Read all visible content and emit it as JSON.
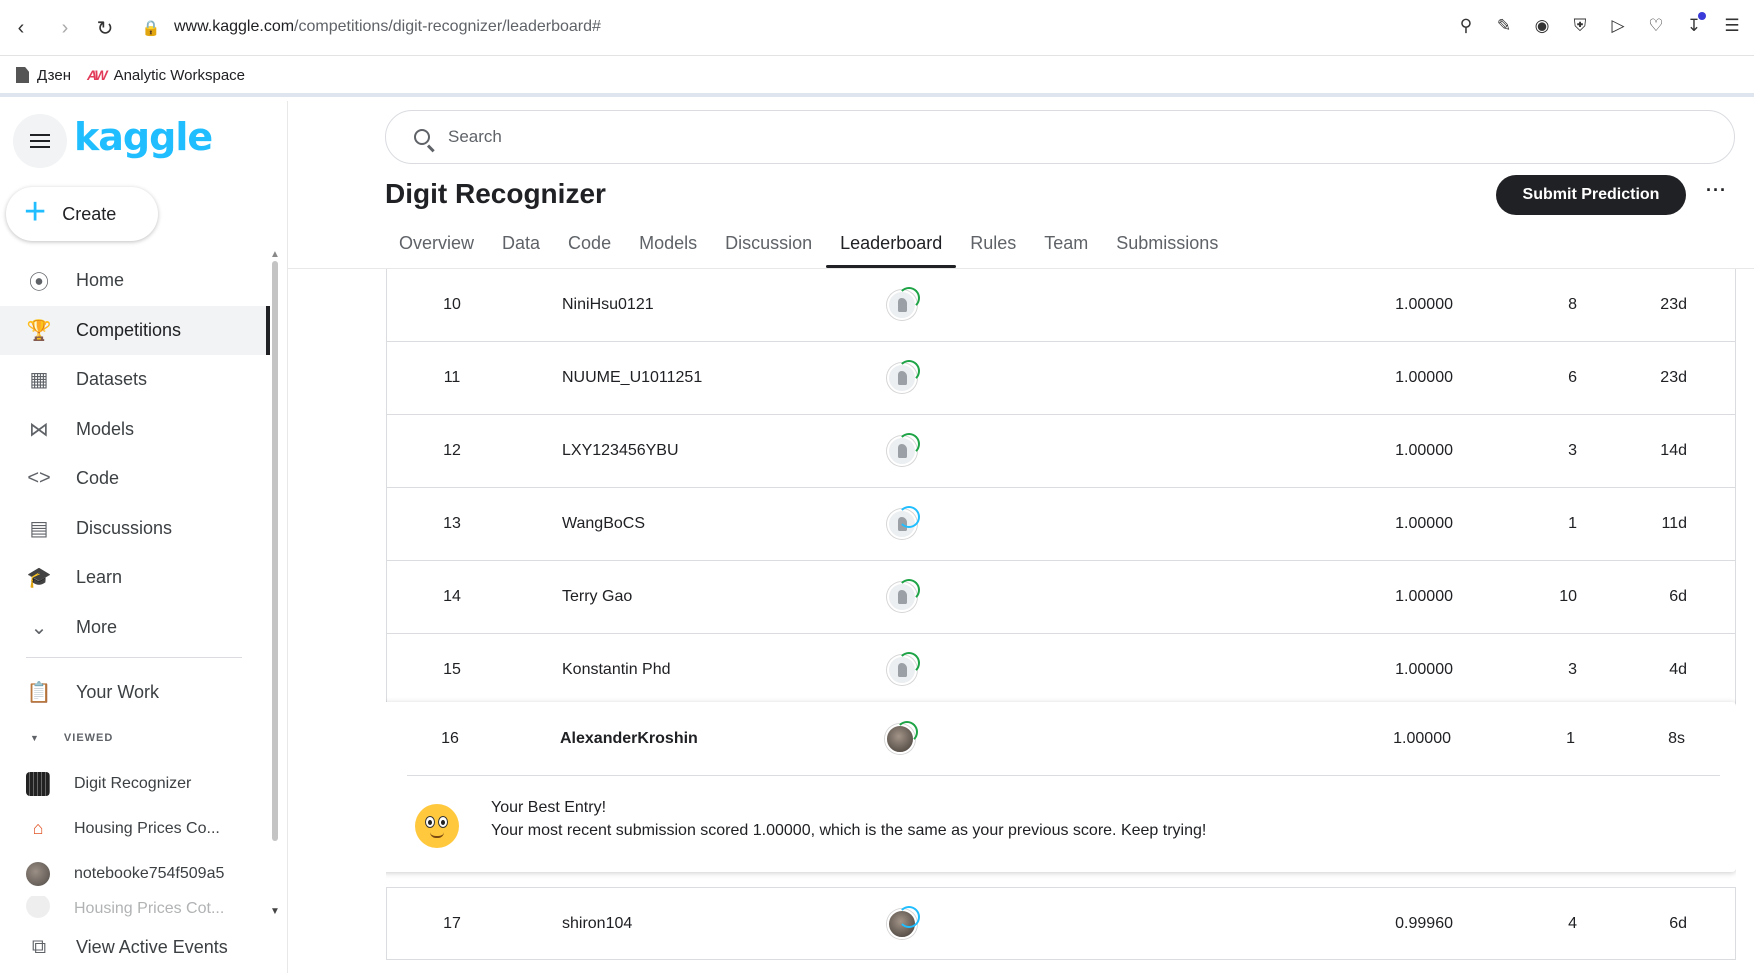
{
  "browser": {
    "url_host": "www.kaggle.com",
    "url_path": "/competitions/digit-recognizer/leaderboard#",
    "bookmarks": [
      "Дзен",
      "Analytic Workspace"
    ]
  },
  "sidebar": {
    "logo": "kaggle",
    "create_label": "Create",
    "nav": [
      {
        "label": "Home",
        "icon": "compass-icon"
      },
      {
        "label": "Competitions",
        "icon": "trophy-icon",
        "active": true
      },
      {
        "label": "Datasets",
        "icon": "table-icon"
      },
      {
        "label": "Models",
        "icon": "models-icon"
      },
      {
        "label": "Code",
        "icon": "code-icon"
      },
      {
        "label": "Discussions",
        "icon": "comment-icon"
      },
      {
        "label": "Learn",
        "icon": "school-icon"
      },
      {
        "label": "More",
        "icon": "chevron-down-icon"
      }
    ],
    "your_work": "Your Work",
    "viewed_heading": "VIEWED",
    "viewed": [
      "Digit Recognizer",
      "Housing Prices Co...",
      "notebooke754f509a5",
      "Housing Prices Cot..."
    ],
    "view_active_events": "View Active Events"
  },
  "search": {
    "placeholder": "Search"
  },
  "competition": {
    "title": "Digit Recognizer",
    "submit_label": "Submit Prediction",
    "more_label": "···",
    "tabs": [
      "Overview",
      "Data",
      "Code",
      "Models",
      "Discussion",
      "Leaderboard",
      "Rules",
      "Team",
      "Submissions"
    ],
    "active_tab": "Leaderboard"
  },
  "leaderboard": {
    "rows": [
      {
        "rank": "10",
        "name": "NiniHsu0121",
        "score": "1.00000",
        "entries": "8",
        "last": "23d"
      },
      {
        "rank": "11",
        "name": "NUUME_U1011251",
        "score": "1.00000",
        "entries": "6",
        "last": "23d"
      },
      {
        "rank": "12",
        "name": "LXY123456YBU",
        "score": "1.00000",
        "entries": "3",
        "last": "14d"
      },
      {
        "rank": "13",
        "name": "WangBoCS",
        "score": "1.00000",
        "entries": "1",
        "last": "11d"
      },
      {
        "rank": "14",
        "name": "Terry Gao",
        "score": "1.00000",
        "entries": "10",
        "last": "6d"
      },
      {
        "rank": "15",
        "name": "Konstantin Phd",
        "score": "1.00000",
        "entries": "3",
        "last": "4d"
      }
    ],
    "mine": {
      "rank": "16",
      "name": "AlexanderKroshin",
      "score": "1.00000",
      "entries": "1",
      "last": "8s",
      "best_title": "Your Best Entry!",
      "best_message": "Your most recent submission scored 1.00000, which is the same as your previous score. Keep trying!"
    },
    "after": [
      {
        "rank": "17",
        "name": "shiron104",
        "score": "0.99960",
        "entries": "4",
        "last": "6d"
      }
    ]
  }
}
